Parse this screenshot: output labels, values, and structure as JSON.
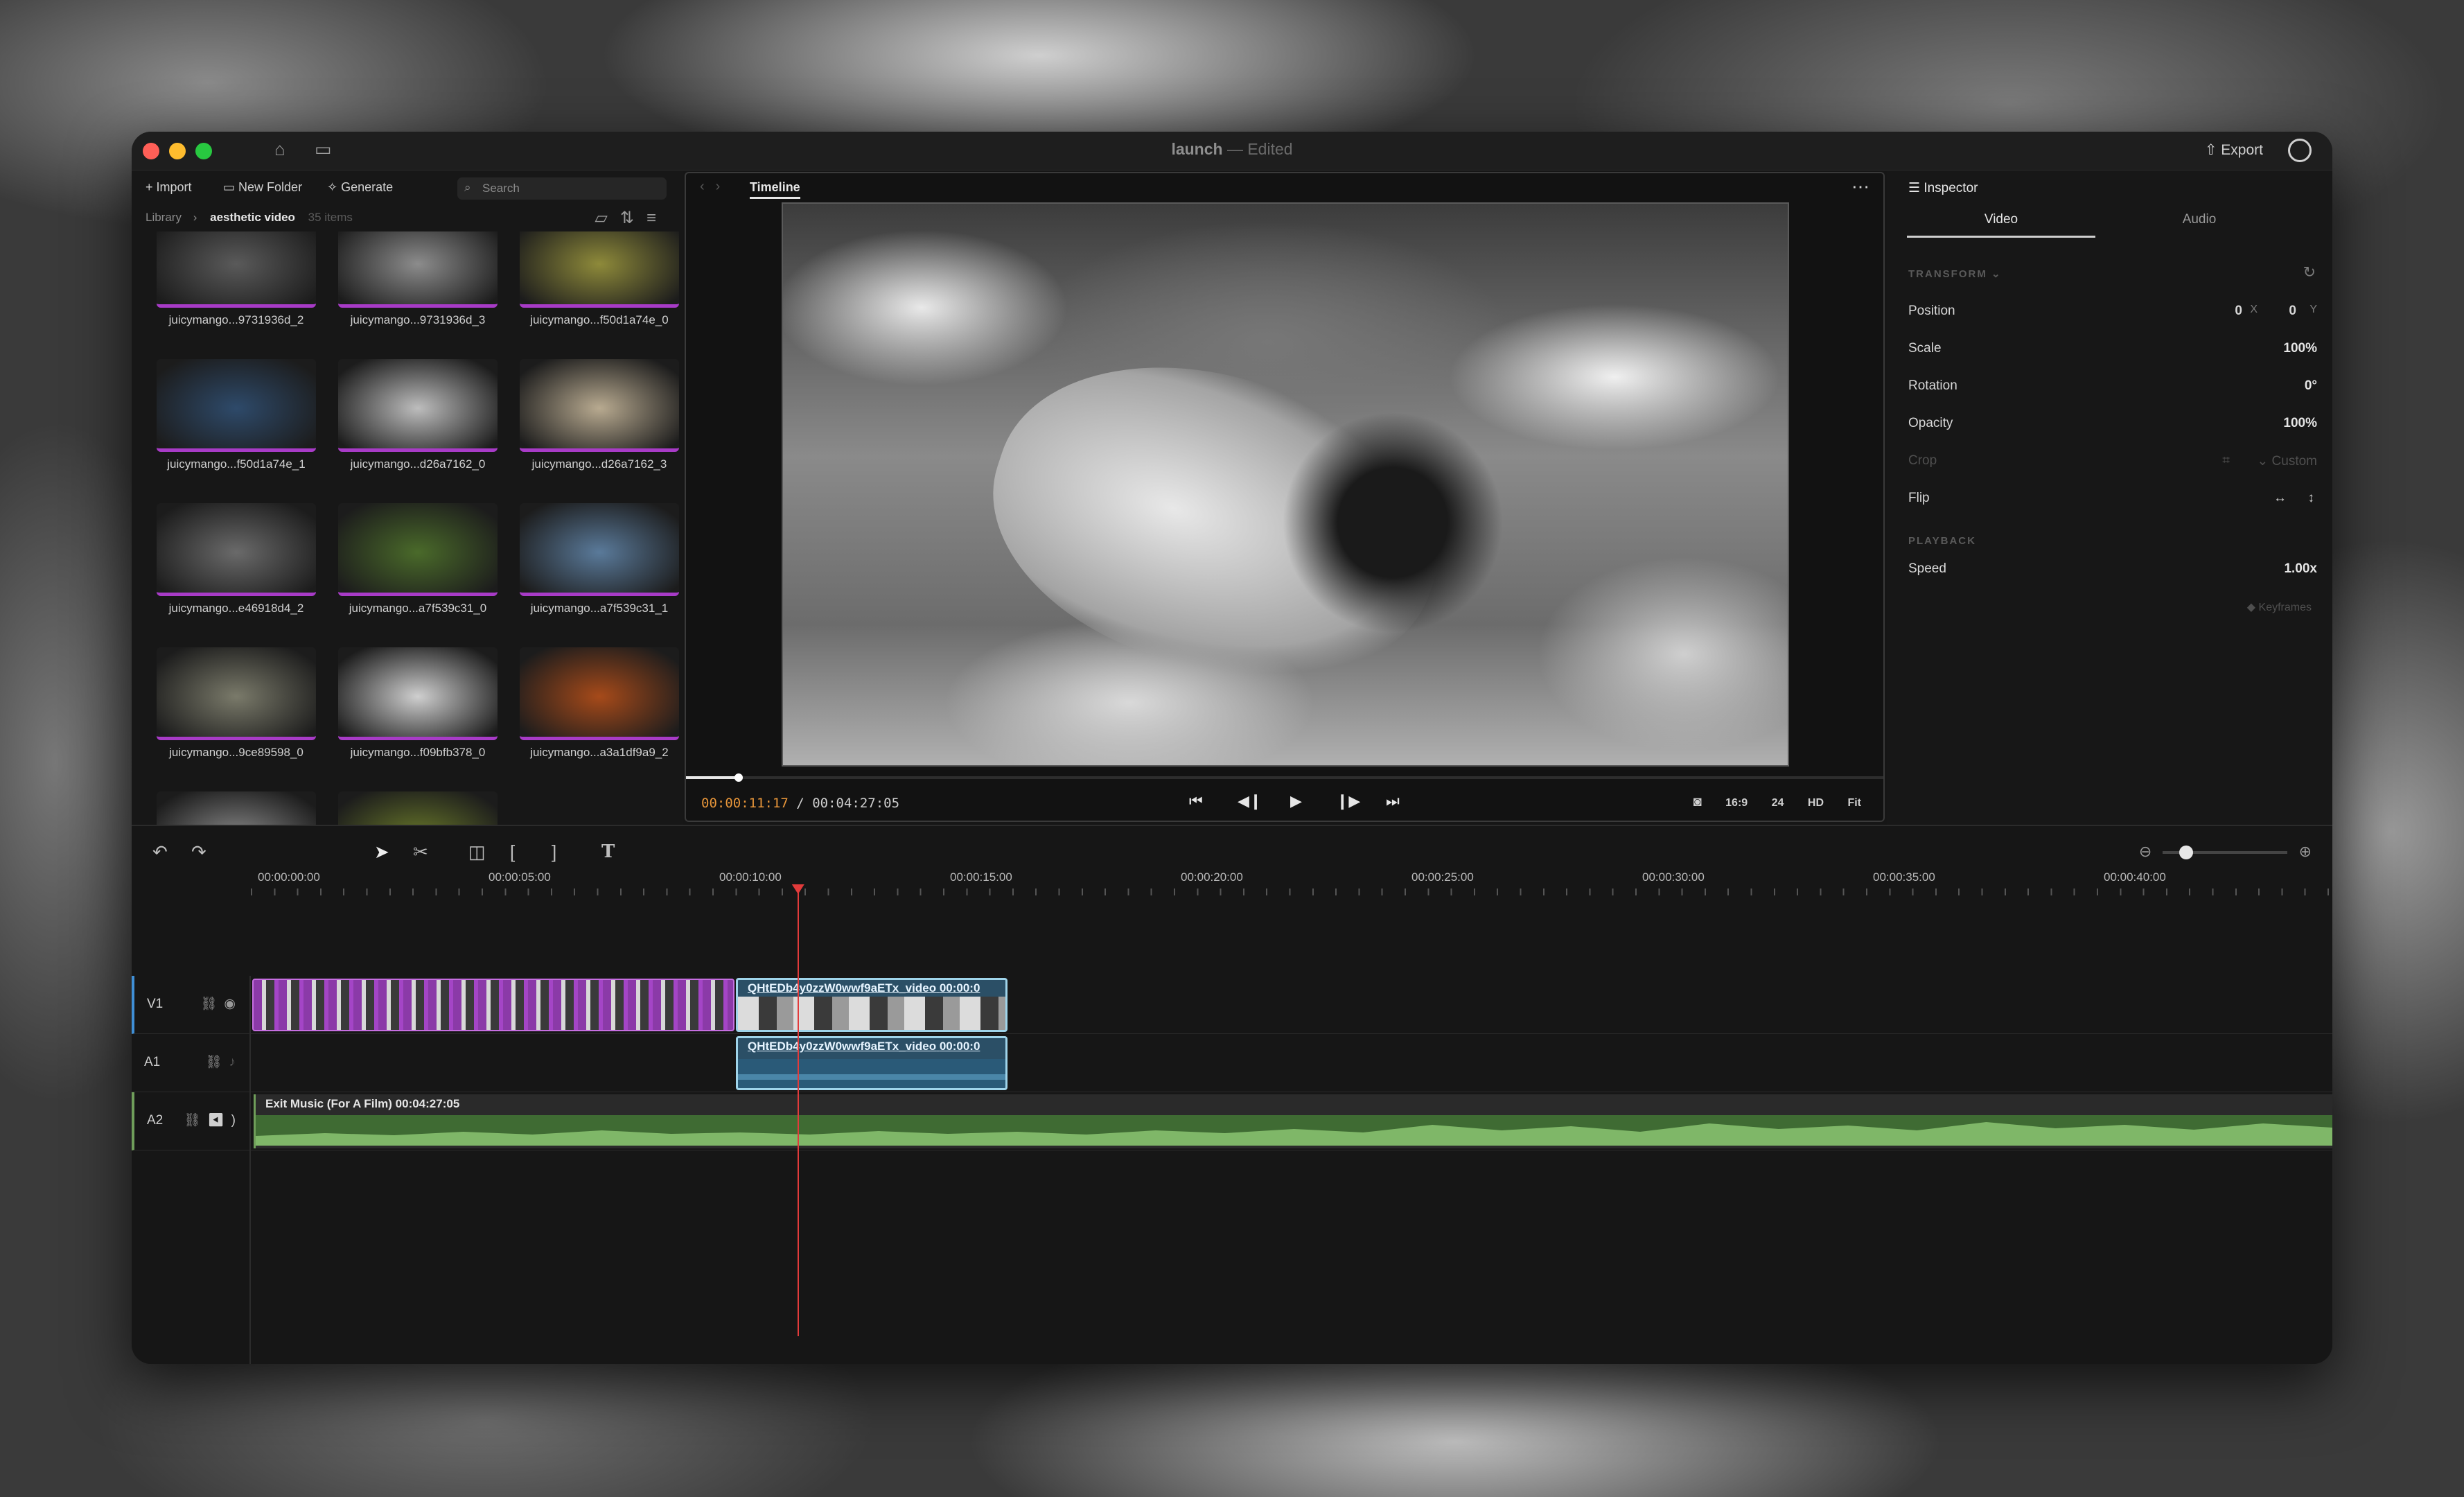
{
  "window": {
    "title": "launch",
    "title_sep": "—",
    "title_status": "Edited",
    "export_label": "Export"
  },
  "library": {
    "toolbar": {
      "import": "Import",
      "new_folder": "New Folder",
      "generate": "Generate",
      "search_placeholder": "Search"
    },
    "breadcrumb": {
      "root": "Library",
      "current": "aesthetic video",
      "count": "35 items"
    },
    "items": [
      {
        "name": "juicymango...9731936d_2",
        "tone": "#5a5a5a"
      },
      {
        "name": "juicymango...9731936d_3",
        "tone": "#8c8c8c"
      },
      {
        "name": "juicymango...f50d1a74e_0",
        "tone": "#8e8a3a"
      },
      {
        "name": "juicymango...f50d1a74e_1",
        "tone": "#2e4a6a"
      },
      {
        "name": "juicymango...d26a7162_0",
        "tone": "#bdbdbd"
      },
      {
        "name": "juicymango...d26a7162_3",
        "tone": "#b8aa90"
      },
      {
        "name": "juicymango...e46918d4_2",
        "tone": "#6a6a6a"
      },
      {
        "name": "juicymango...a7f539c31_0",
        "tone": "#4a6a2a"
      },
      {
        "name": "juicymango...a7f539c31_1",
        "tone": "#5a7a9a"
      },
      {
        "name": "juicymango...9ce89598_0",
        "tone": "#7a7a6a"
      },
      {
        "name": "juicymango...f09bfb378_0",
        "tone": "#cfcfcf"
      },
      {
        "name": "juicymango...a3a1df9a9_2",
        "tone": "#a64a1a"
      },
      {
        "name": "",
        "tone": "#8a8a8a"
      },
      {
        "name": "",
        "tone": "#6a7a2a"
      }
    ]
  },
  "viewer": {
    "tab": "Timeline",
    "current_time": "00:00:11:17",
    "total_time": "00:04:27:05",
    "progress": 0.044,
    "aspect": "16:9",
    "fps": "24",
    "quality": "HD",
    "fit": "Fit"
  },
  "inspector": {
    "title": "Inspector",
    "tabs": [
      "Video",
      "Audio"
    ],
    "transform_label": "TRANSFORM",
    "position_label": "Position",
    "position_x": "0",
    "position_x_unit": "X",
    "position_y": "0",
    "position_y_unit": "Y",
    "scale_label": "Scale",
    "scale": "100%",
    "rotation_label": "Rotation",
    "rotation": "0°",
    "opacity_label": "Opacity",
    "opacity": "100%",
    "crop_label": "Crop",
    "crop_value": "Custom",
    "flip_label": "Flip",
    "playback_label": "PLAYBACK",
    "speed_label": "Speed",
    "speed": "1.00x",
    "keyframes_label": "Keyframes"
  },
  "timeline": {
    "ruler": [
      "00:00:00:00",
      "00:00:05:00",
      "00:00:10:00",
      "00:00:15:00",
      "00:00:20:00",
      "00:00:25:00",
      "00:00:30:00",
      "00:00:35:00",
      "00:00:40:00"
    ],
    "tracks": [
      "V1",
      "A1",
      "A2"
    ],
    "video_clip_label": "QHtEDb4y0zzW0wwf9aETx_video",
    "video_clip_time": "00:00:0",
    "audio_clip_label": "QHtEDb4y0zzW0wwf9aETx_video",
    "audio_clip_time": "00:00:0",
    "music_clip_label": "Exit Music (For A Film)",
    "music_clip_time": "00:04:27:05"
  }
}
